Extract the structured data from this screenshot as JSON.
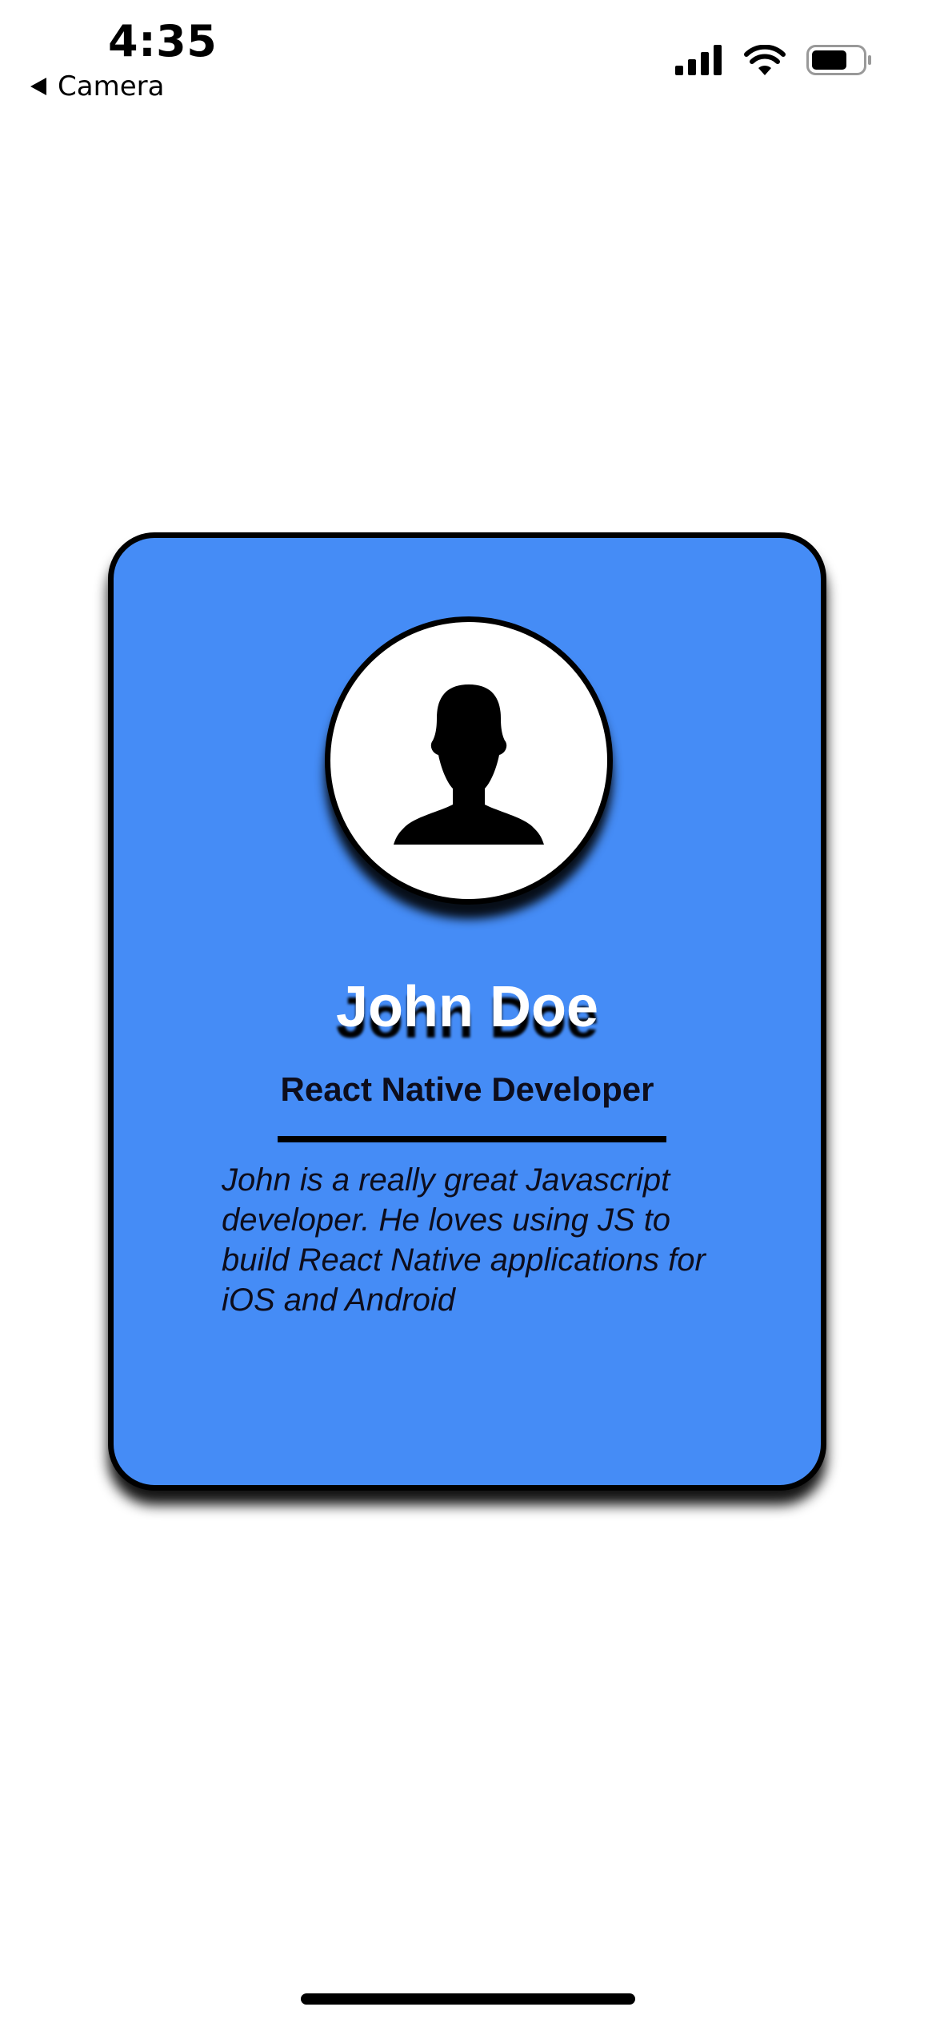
{
  "status_bar": {
    "time": "4:35",
    "back_label": "Camera",
    "icons": [
      "cellular-signal-icon",
      "wifi-icon",
      "battery-icon"
    ],
    "battery_level": 0.7
  },
  "card": {
    "background_color": "#458cf6",
    "avatar_icon": "person-silhouette-icon",
    "name": "John Doe",
    "title": "React Native Developer",
    "bio": "John is a really great Javascript developer. He loves using JS to build React Native applications for iOS and Android"
  }
}
